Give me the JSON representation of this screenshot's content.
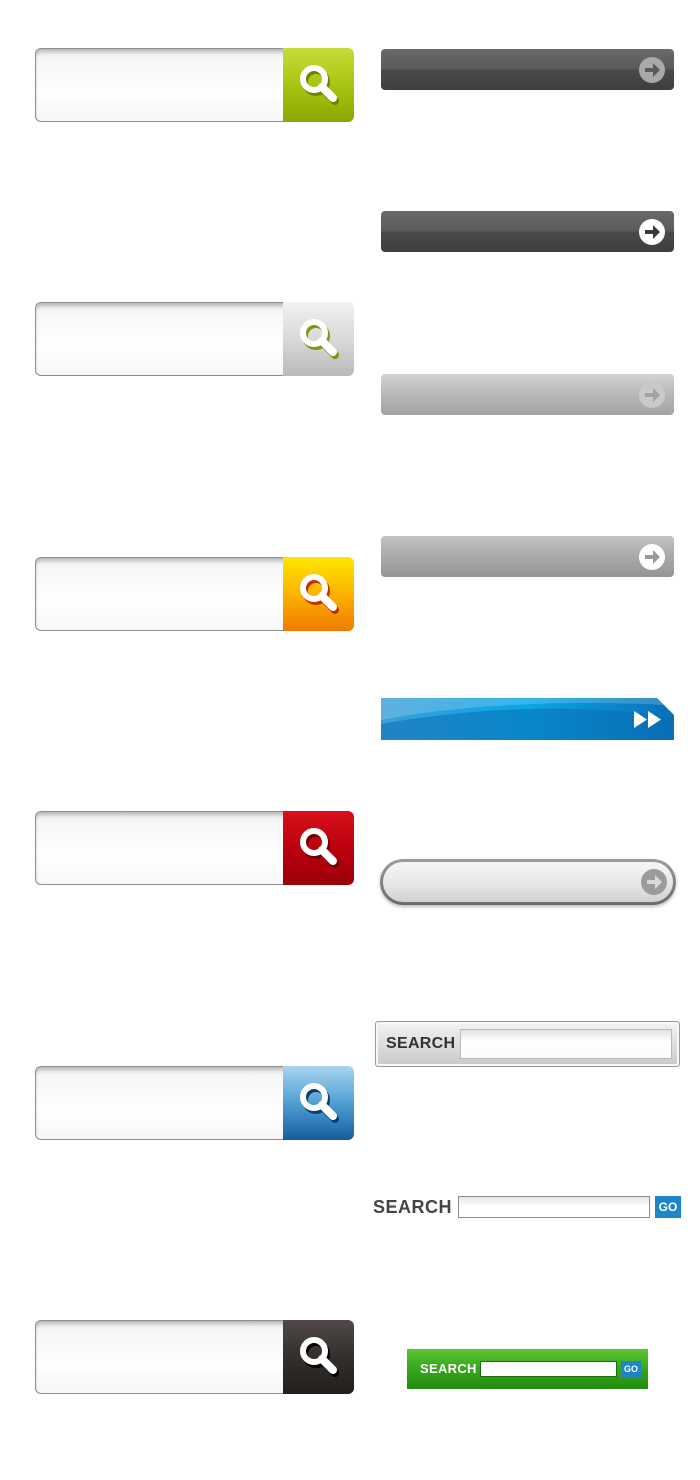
{
  "left_search_boxes": [
    {
      "name": "green",
      "accent": "#9bbd00"
    },
    {
      "name": "silver",
      "accent": "#c8c8c8"
    },
    {
      "name": "orange",
      "accent": "#f49a00"
    },
    {
      "name": "red",
      "accent": "#c1000c"
    },
    {
      "name": "blue",
      "accent": "#1e6fb2"
    },
    {
      "name": "black",
      "accent": "#2a2624"
    }
  ],
  "right_bars": [
    {
      "style": "dark-grey-muted-arrow"
    },
    {
      "style": "dark-grey-white-arrow"
    },
    {
      "style": "light-grey-muted-arrow"
    },
    {
      "style": "light-grey-white-arrow"
    },
    {
      "style": "blue-wave-double-arrow"
    },
    {
      "style": "rounded-pill-arrow"
    }
  ],
  "labelled_bars": {
    "silver": {
      "label": "SEARCH"
    },
    "plain": {
      "label": "SEARCH",
      "go": "GO"
    },
    "green": {
      "label": "SEARCH",
      "go": "GO"
    }
  },
  "colors": {
    "blue_go": "#1e86c8",
    "green_bar": "#37a51c"
  }
}
